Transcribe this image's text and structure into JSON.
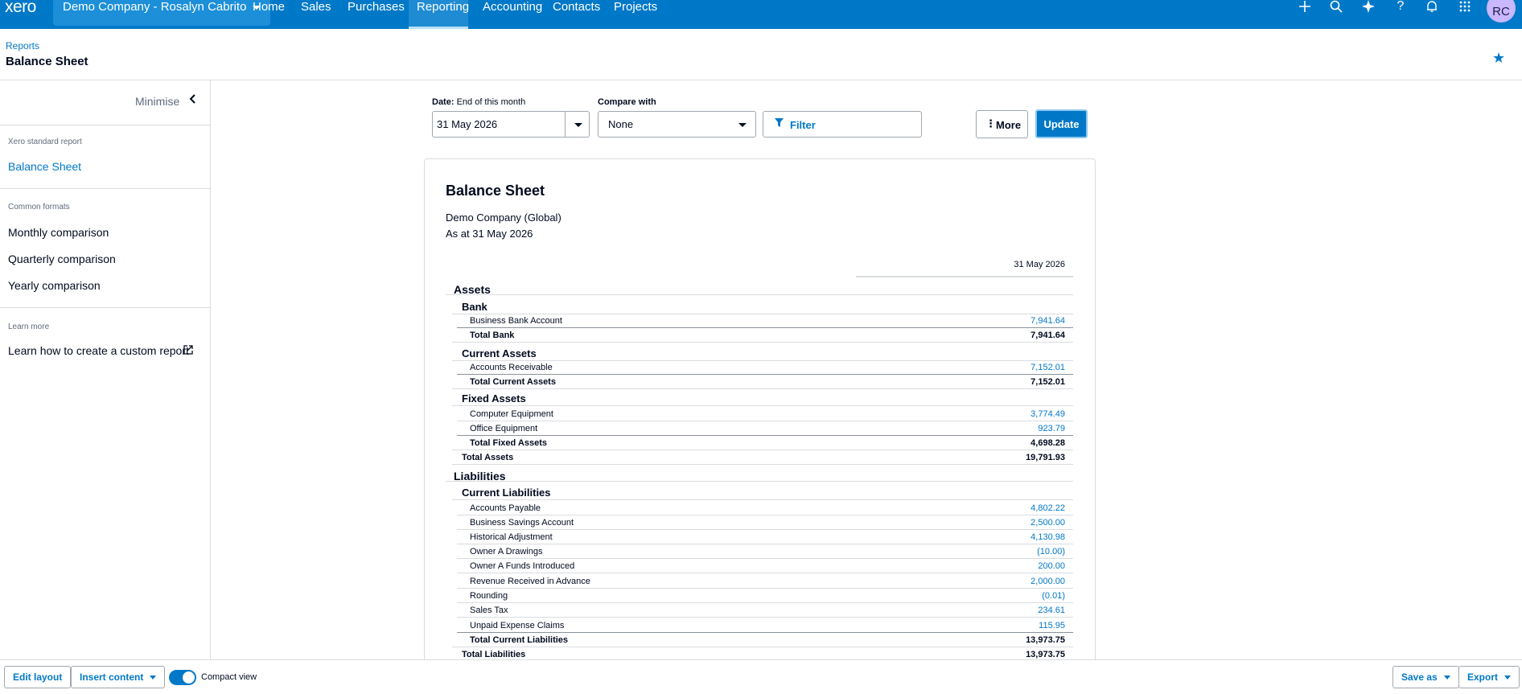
{
  "app": {
    "logo": "xero",
    "org_name": "Demo Company - Rosalyn Cabrito",
    "nav": [
      "Home",
      "Sales",
      "Purchases",
      "Reporting",
      "Accounting",
      "Contacts",
      "Projects"
    ],
    "active_nav": "Reporting",
    "avatar_initials": "RC",
    "brand_color": "#0078c8"
  },
  "header": {
    "breadcrumb": "Reports",
    "title": "Balance Sheet"
  },
  "sidebar": {
    "minimise_label": "Minimise",
    "standard_caption": "Xero standard report",
    "standard_link": "Balance Sheet",
    "common_caption": "Common formats",
    "common_links": [
      "Monthly comparison",
      "Quarterly comparison",
      "Yearly comparison"
    ],
    "learn_caption": "Learn more",
    "learn_link": "Learn how to create a custom report"
  },
  "controls": {
    "date_label_bold": "Date:",
    "date_label_rest": "End of this month",
    "date_value": "31 May 2026",
    "compare_label": "Compare with",
    "compare_value": "None",
    "filter_label": "Filter",
    "more_label": "More",
    "update_label": "Update"
  },
  "report": {
    "title": "Balance Sheet",
    "company": "Demo Company (Global)",
    "as_at": "As at 31 May 2026",
    "column": "31 May 2026",
    "rows": [
      {
        "type": "sec",
        "name": "Assets",
        "amount": ""
      },
      {
        "type": "sub",
        "name": "Bank",
        "amount": ""
      },
      {
        "type": "item",
        "name": "Business Bank Account",
        "amount": "7,941.64"
      },
      {
        "type": "total",
        "name": "Total Bank",
        "amount": "7,941.64"
      },
      {
        "type": "sub",
        "name": "Current Assets",
        "amount": ""
      },
      {
        "type": "item",
        "name": "Accounts Receivable",
        "amount": "7,152.01"
      },
      {
        "type": "total",
        "name": "Total Current Assets",
        "amount": "7,152.01"
      },
      {
        "type": "sub",
        "name": "Fixed Assets",
        "amount": ""
      },
      {
        "type": "item",
        "name": "Computer Equipment",
        "amount": "3,774.49"
      },
      {
        "type": "item",
        "name": "Office Equipment",
        "amount": "923.79"
      },
      {
        "type": "total",
        "name": "Total Fixed Assets",
        "amount": "4,698.28"
      },
      {
        "type": "grand",
        "name": "Total Assets",
        "amount": "19,791.93"
      },
      {
        "type": "sec",
        "name": "Liabilities",
        "amount": ""
      },
      {
        "type": "sub",
        "name": "Current Liabilities",
        "amount": ""
      },
      {
        "type": "item",
        "name": "Accounts Payable",
        "amount": "4,802.22"
      },
      {
        "type": "item",
        "name": "Business Savings Account",
        "amount": "2,500.00"
      },
      {
        "type": "item",
        "name": "Historical Adjustment",
        "amount": "4,130.98"
      },
      {
        "type": "item",
        "name": "Owner A Drawings",
        "amount": "(10.00)"
      },
      {
        "type": "item",
        "name": "Owner A Funds Introduced",
        "amount": "200.00"
      },
      {
        "type": "item",
        "name": "Revenue Received in Advance",
        "amount": "2,000.00"
      },
      {
        "type": "item",
        "name": "Rounding",
        "amount": "(0.01)"
      },
      {
        "type": "item",
        "name": "Sales Tax",
        "amount": "234.61"
      },
      {
        "type": "item",
        "name": "Unpaid Expense Claims",
        "amount": "115.95"
      },
      {
        "type": "total",
        "name": "Total Current Liabilities",
        "amount": "13,973.75"
      },
      {
        "type": "grand",
        "name": "Total Liabilities",
        "amount": "13,973.75"
      }
    ]
  },
  "footer": {
    "edit_layout": "Edit layout",
    "insert_content": "Insert content",
    "compact_view": "Compact view",
    "save_as": "Save as",
    "export": "Export"
  },
  "icons": {
    "add": "+",
    "search": "⌕",
    "assistant": "✦",
    "help": "?",
    "notifications": "bell",
    "apps": "grid",
    "star": "★",
    "chevron_left": "‹",
    "external": "↗",
    "filter": "funnel",
    "more": "⋮"
  }
}
